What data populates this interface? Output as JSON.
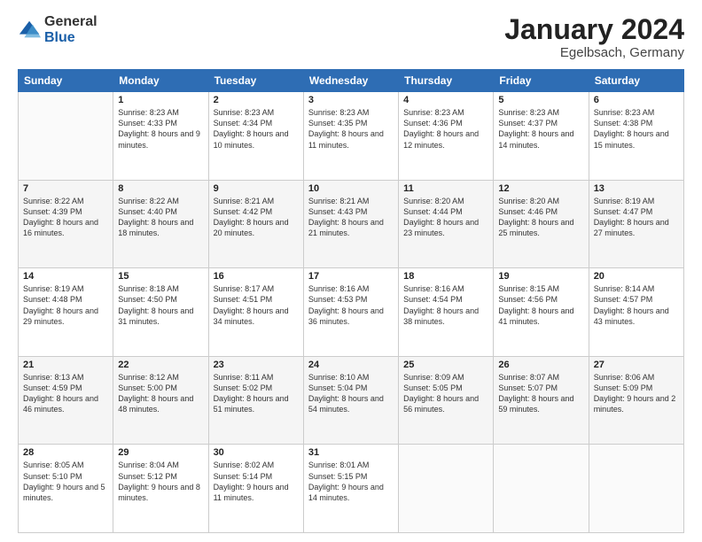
{
  "logo": {
    "general": "General",
    "blue": "Blue"
  },
  "header": {
    "title": "January 2024",
    "location": "Egelbsach, Germany"
  },
  "weekdays": [
    "Sunday",
    "Monday",
    "Tuesday",
    "Wednesday",
    "Thursday",
    "Friday",
    "Saturday"
  ],
  "weeks": [
    [
      {
        "day": "",
        "sunrise": "",
        "sunset": "",
        "daylight": ""
      },
      {
        "day": "1",
        "sunrise": "Sunrise: 8:23 AM",
        "sunset": "Sunset: 4:33 PM",
        "daylight": "Daylight: 8 hours and 9 minutes."
      },
      {
        "day": "2",
        "sunrise": "Sunrise: 8:23 AM",
        "sunset": "Sunset: 4:34 PM",
        "daylight": "Daylight: 8 hours and 10 minutes."
      },
      {
        "day": "3",
        "sunrise": "Sunrise: 8:23 AM",
        "sunset": "Sunset: 4:35 PM",
        "daylight": "Daylight: 8 hours and 11 minutes."
      },
      {
        "day": "4",
        "sunrise": "Sunrise: 8:23 AM",
        "sunset": "Sunset: 4:36 PM",
        "daylight": "Daylight: 8 hours and 12 minutes."
      },
      {
        "day": "5",
        "sunrise": "Sunrise: 8:23 AM",
        "sunset": "Sunset: 4:37 PM",
        "daylight": "Daylight: 8 hours and 14 minutes."
      },
      {
        "day": "6",
        "sunrise": "Sunrise: 8:23 AM",
        "sunset": "Sunset: 4:38 PM",
        "daylight": "Daylight: 8 hours and 15 minutes."
      }
    ],
    [
      {
        "day": "7",
        "sunrise": "Sunrise: 8:22 AM",
        "sunset": "Sunset: 4:39 PM",
        "daylight": "Daylight: 8 hours and 16 minutes."
      },
      {
        "day": "8",
        "sunrise": "Sunrise: 8:22 AM",
        "sunset": "Sunset: 4:40 PM",
        "daylight": "Daylight: 8 hours and 18 minutes."
      },
      {
        "day": "9",
        "sunrise": "Sunrise: 8:21 AM",
        "sunset": "Sunset: 4:42 PM",
        "daylight": "Daylight: 8 hours and 20 minutes."
      },
      {
        "day": "10",
        "sunrise": "Sunrise: 8:21 AM",
        "sunset": "Sunset: 4:43 PM",
        "daylight": "Daylight: 8 hours and 21 minutes."
      },
      {
        "day": "11",
        "sunrise": "Sunrise: 8:20 AM",
        "sunset": "Sunset: 4:44 PM",
        "daylight": "Daylight: 8 hours and 23 minutes."
      },
      {
        "day": "12",
        "sunrise": "Sunrise: 8:20 AM",
        "sunset": "Sunset: 4:46 PM",
        "daylight": "Daylight: 8 hours and 25 minutes."
      },
      {
        "day": "13",
        "sunrise": "Sunrise: 8:19 AM",
        "sunset": "Sunset: 4:47 PM",
        "daylight": "Daylight: 8 hours and 27 minutes."
      }
    ],
    [
      {
        "day": "14",
        "sunrise": "Sunrise: 8:19 AM",
        "sunset": "Sunset: 4:48 PM",
        "daylight": "Daylight: 8 hours and 29 minutes."
      },
      {
        "day": "15",
        "sunrise": "Sunrise: 8:18 AM",
        "sunset": "Sunset: 4:50 PM",
        "daylight": "Daylight: 8 hours and 31 minutes."
      },
      {
        "day": "16",
        "sunrise": "Sunrise: 8:17 AM",
        "sunset": "Sunset: 4:51 PM",
        "daylight": "Daylight: 8 hours and 34 minutes."
      },
      {
        "day": "17",
        "sunrise": "Sunrise: 8:16 AM",
        "sunset": "Sunset: 4:53 PM",
        "daylight": "Daylight: 8 hours and 36 minutes."
      },
      {
        "day": "18",
        "sunrise": "Sunrise: 8:16 AM",
        "sunset": "Sunset: 4:54 PM",
        "daylight": "Daylight: 8 hours and 38 minutes."
      },
      {
        "day": "19",
        "sunrise": "Sunrise: 8:15 AM",
        "sunset": "Sunset: 4:56 PM",
        "daylight": "Daylight: 8 hours and 41 minutes."
      },
      {
        "day": "20",
        "sunrise": "Sunrise: 8:14 AM",
        "sunset": "Sunset: 4:57 PM",
        "daylight": "Daylight: 8 hours and 43 minutes."
      }
    ],
    [
      {
        "day": "21",
        "sunrise": "Sunrise: 8:13 AM",
        "sunset": "Sunset: 4:59 PM",
        "daylight": "Daylight: 8 hours and 46 minutes."
      },
      {
        "day": "22",
        "sunrise": "Sunrise: 8:12 AM",
        "sunset": "Sunset: 5:00 PM",
        "daylight": "Daylight: 8 hours and 48 minutes."
      },
      {
        "day": "23",
        "sunrise": "Sunrise: 8:11 AM",
        "sunset": "Sunset: 5:02 PM",
        "daylight": "Daylight: 8 hours and 51 minutes."
      },
      {
        "day": "24",
        "sunrise": "Sunrise: 8:10 AM",
        "sunset": "Sunset: 5:04 PM",
        "daylight": "Daylight: 8 hours and 54 minutes."
      },
      {
        "day": "25",
        "sunrise": "Sunrise: 8:09 AM",
        "sunset": "Sunset: 5:05 PM",
        "daylight": "Daylight: 8 hours and 56 minutes."
      },
      {
        "day": "26",
        "sunrise": "Sunrise: 8:07 AM",
        "sunset": "Sunset: 5:07 PM",
        "daylight": "Daylight: 8 hours and 59 minutes."
      },
      {
        "day": "27",
        "sunrise": "Sunrise: 8:06 AM",
        "sunset": "Sunset: 5:09 PM",
        "daylight": "Daylight: 9 hours and 2 minutes."
      }
    ],
    [
      {
        "day": "28",
        "sunrise": "Sunrise: 8:05 AM",
        "sunset": "Sunset: 5:10 PM",
        "daylight": "Daylight: 9 hours and 5 minutes."
      },
      {
        "day": "29",
        "sunrise": "Sunrise: 8:04 AM",
        "sunset": "Sunset: 5:12 PM",
        "daylight": "Daylight: 9 hours and 8 minutes."
      },
      {
        "day": "30",
        "sunrise": "Sunrise: 8:02 AM",
        "sunset": "Sunset: 5:14 PM",
        "daylight": "Daylight: 9 hours and 11 minutes."
      },
      {
        "day": "31",
        "sunrise": "Sunrise: 8:01 AM",
        "sunset": "Sunset: 5:15 PM",
        "daylight": "Daylight: 9 hours and 14 minutes."
      },
      {
        "day": "",
        "sunrise": "",
        "sunset": "",
        "daylight": ""
      },
      {
        "day": "",
        "sunrise": "",
        "sunset": "",
        "daylight": ""
      },
      {
        "day": "",
        "sunrise": "",
        "sunset": "",
        "daylight": ""
      }
    ]
  ]
}
